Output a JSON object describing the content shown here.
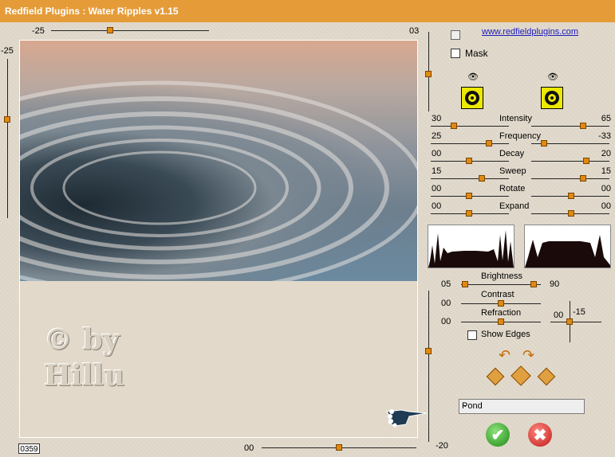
{
  "window": {
    "title": "Redfield Plugins : Water Ripples v1.15"
  },
  "colors": {
    "title_bar": "#e59c38",
    "thumb": "#e08a10",
    "ok": "#1d8a14",
    "cancel": "#c01818"
  },
  "top_slider": {
    "left_value": "-25",
    "right_value": "03"
  },
  "left_slider": {
    "value": "-25"
  },
  "bottom_slider": {
    "value": "00"
  },
  "right_vslider": {
    "bottom_value": "-20"
  },
  "link": {
    "text": "www.redfieldplugins.com"
  },
  "mask": {
    "label": "Mask",
    "checked": false
  },
  "params": [
    {
      "name": "Intensity",
      "left": "30",
      "right": "65"
    },
    {
      "name": "Frequency",
      "left": "25",
      "right": "-33"
    },
    {
      "name": "Decay",
      "left": "00",
      "right": "20"
    },
    {
      "name": "Sweep",
      "left": "15",
      "right": "15"
    },
    {
      "name": "Rotate",
      "left": "00",
      "right": "00"
    },
    {
      "name": "Expand",
      "left": "00",
      "right": "00"
    }
  ],
  "adjust": {
    "brightness": {
      "label": "Brightness",
      "left": "05",
      "right": "90"
    },
    "contrast": {
      "label": "Contrast",
      "left": "00"
    },
    "refraction": {
      "label": "Refraction",
      "left": "00"
    },
    "cross_left": "00",
    "cross_right": "-15"
  },
  "show_edges": {
    "label": "Show Edges",
    "checked": false
  },
  "preset": {
    "selected": "Pond"
  },
  "frame_counter": "0359",
  "icons": {
    "eye_left": "eye-icon",
    "eye_right": "eye-icon",
    "ok": "checkmark-icon",
    "cancel": "x-icon",
    "rotate_left": "rotate-left-arrow-icon",
    "rotate_right": "rotate-right-arrow-icon",
    "dice": "dice-icon",
    "hand": "pointing-hand-icon"
  }
}
